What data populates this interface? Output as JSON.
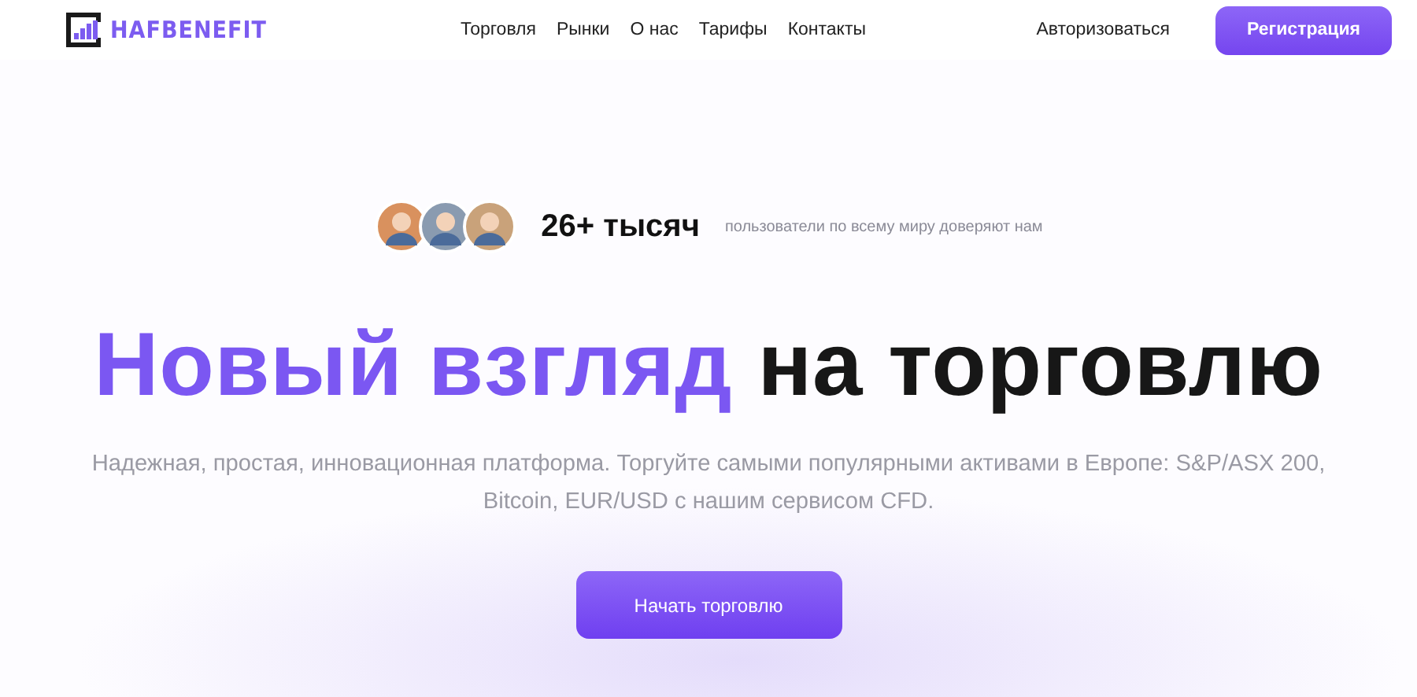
{
  "logo": {
    "text": "HAFBENEFIT"
  },
  "nav": [
    "Торговля",
    "Рынки",
    "О нас",
    "Тарифы",
    "Контакты"
  ],
  "login": "Авторизоваться",
  "register": "Регистрация",
  "trust": {
    "avatars": [
      {
        "kind": "avatar"
      },
      {
        "kind": "avatar"
      },
      {
        "kind": "avatar"
      }
    ],
    "count": "26+ тысяч",
    "caption": "пользователи по всему миру доверяют нам"
  },
  "headline": {
    "highlight": "Новый взгляд",
    "rest": "на торговлю"
  },
  "subtitle": "Надежная, простая, инновационная платформа. Торгуйте самыми популярными активами в Европе: S&P/ASX 200, Bitcoin, EUR/USD с нашим сервисом CFD.",
  "cta": "Начать торговлю"
}
